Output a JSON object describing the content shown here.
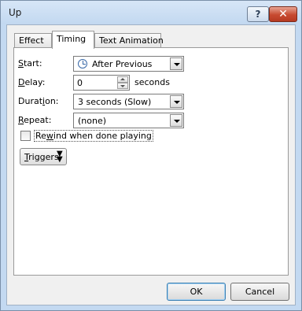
{
  "window": {
    "title": "Up",
    "help_label": "?",
    "close_label": "✕"
  },
  "tabs": [
    {
      "label": "Effect",
      "active": false
    },
    {
      "label": "Timing",
      "active": true
    },
    {
      "label": "Text Animation",
      "active": false
    }
  ],
  "timing": {
    "start": {
      "label_underlined": "S",
      "label_rest": "tart:",
      "value": "After Previous",
      "icon": "clock-icon"
    },
    "delay": {
      "label_underlined": "D",
      "label_rest": "elay:",
      "value": "0",
      "unit": "seconds"
    },
    "duration": {
      "label_first": "Durat",
      "label_underlined": "i",
      "label_rest": "on:",
      "value": "3 seconds (Slow)"
    },
    "repeat": {
      "label_underlined": "R",
      "label_rest": "epeat:",
      "value": "(none)"
    },
    "rewind": {
      "label_first": "Re",
      "label_underlined": "w",
      "label_rest": "ind when done playing",
      "checked": false
    },
    "triggers": {
      "label_underlined": "T",
      "label_rest": "riggers",
      "icon": "chevron-double-down-icon"
    }
  },
  "footer": {
    "ok_label": "OK",
    "cancel_label": "Cancel"
  }
}
